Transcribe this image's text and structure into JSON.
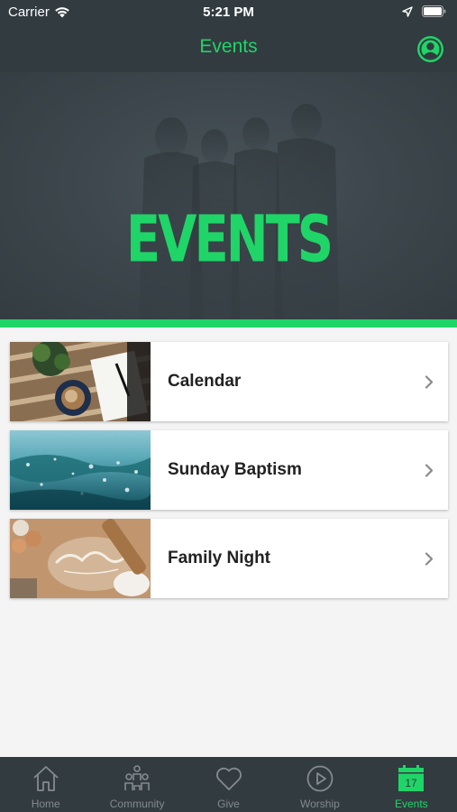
{
  "status_bar": {
    "carrier": "Carrier",
    "time": "5:21 PM"
  },
  "nav": {
    "title": "Events"
  },
  "hero": {
    "text": "EVENTS"
  },
  "events": [
    {
      "label": "Calendar"
    },
    {
      "label": "Sunday Baptism"
    },
    {
      "label": "Family Night"
    }
  ],
  "tabs": [
    {
      "label": "Home",
      "icon": "home-icon"
    },
    {
      "label": "Community",
      "icon": "community-icon"
    },
    {
      "label": "Give",
      "icon": "heart-icon"
    },
    {
      "label": "Worship",
      "icon": "play-icon"
    },
    {
      "label": "Events",
      "icon": "calendar-icon",
      "badge": "17",
      "active": true
    }
  ],
  "colors": {
    "accent": "#1fd567",
    "bar_bg": "#323b40",
    "page_bg": "#f4f4f4",
    "tab_inactive": "#848b8f"
  }
}
